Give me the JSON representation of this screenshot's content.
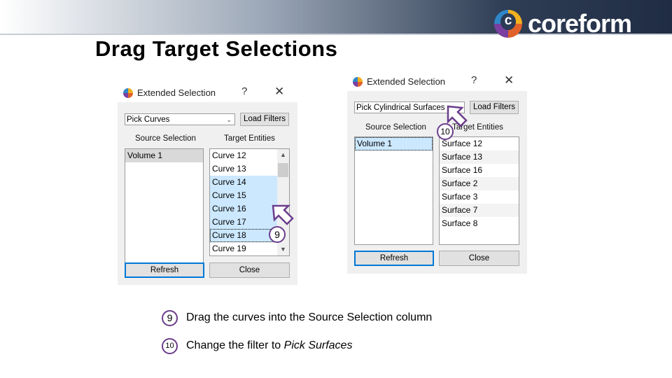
{
  "brand": {
    "name": "coreform"
  },
  "slide": {
    "title": "Drag Target Selections"
  },
  "dialog1": {
    "title": "Extended Selection",
    "help": "?",
    "close": "✕",
    "filter": "Pick Curves",
    "load_filters": "Load Filters",
    "source_label": "Source Selection",
    "target_label": "Target Entities",
    "source_items": [
      "Volume 1"
    ],
    "target_items": [
      "Curve 12",
      "Curve 13",
      "Curve 14",
      "Curve 15",
      "Curve 16",
      "Curve 17",
      "Curve 18",
      "Curve 19"
    ],
    "refresh": "Refresh",
    "close_button": "Close",
    "callout": "9"
  },
  "dialog2": {
    "title": "Extended Selection",
    "help": "?",
    "close": "✕",
    "filter": "Pick Cylindrical Surfaces",
    "load_filters": "Load Filters",
    "source_label": "Source Selection",
    "target_label": "Target Entities",
    "source_items": [
      "Volume 1"
    ],
    "target_items": [
      "Surface 12",
      "Surface 13",
      "Surface 16",
      "Surface 2",
      "Surface 3",
      "Surface 7",
      "Surface 8"
    ],
    "refresh": "Refresh",
    "close_button": "Close",
    "callout": "10"
  },
  "steps": [
    {
      "num": "9",
      "text": "Drag the curves into the Source Selection column"
    },
    {
      "num": "10",
      "text_prefix": "Change the filter to ",
      "text_italic": "Pick Surfaces"
    }
  ]
}
